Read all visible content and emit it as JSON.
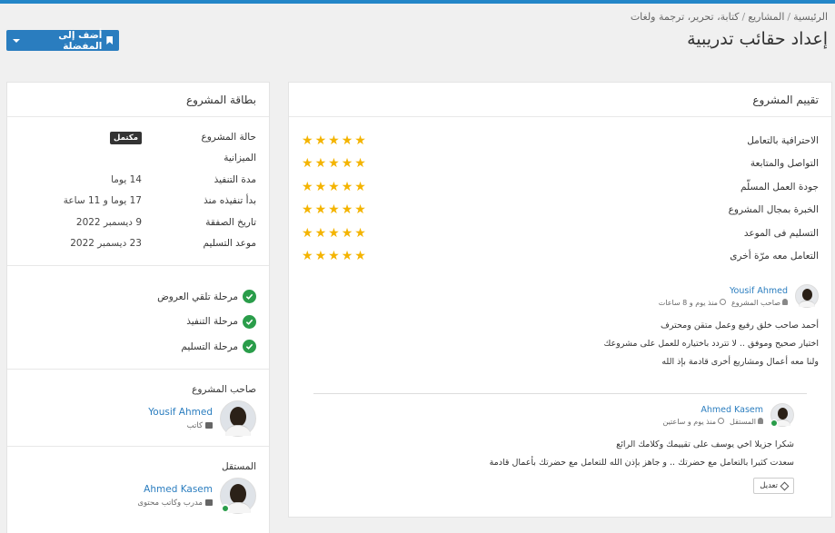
{
  "breadcrumb": [
    "الرئيسية",
    "المشاريع",
    "كتابة، تحرير، ترجمة ولغات"
  ],
  "page_title": "إعداد حقائب تدريبية",
  "favorite_button": {
    "label": "أضف إلى المفضلة"
  },
  "project_card": {
    "title": "بطاقة المشروع",
    "rows": [
      {
        "key": "حالة المشروع",
        "value": "مكتمل"
      },
      {
        "key": "الميزانية",
        "value": ""
      },
      {
        "key": "مدة التنفيذ",
        "value": "14 يوما"
      },
      {
        "key": "بدأ تنفيذه منذ",
        "value": "17 يوما و 11 ساعة"
      },
      {
        "key": "تاريخ الصفقة",
        "value": "9 ديسمبر 2022"
      },
      {
        "key": "موعد التسليم",
        "value": "23 ديسمبر 2022"
      }
    ],
    "steps": [
      "مرحلة تلقي العروض",
      "مرحلة التنفيذ",
      "مرحلة التسليم"
    ],
    "owner": {
      "label": "صاحب المشروع",
      "name": "Yousif Ahmed",
      "role": "كاتب"
    },
    "freelancer": {
      "label": "المستقل",
      "name": "Ahmed Kasem",
      "role": "مدرب وكاتب محتوى"
    }
  },
  "rating_card": {
    "title": "تقييم المشروع",
    "criteria": [
      {
        "label": "الاحترافية بالتعامل",
        "stars": 5
      },
      {
        "label": "التواصل والمتابعة",
        "stars": 5
      },
      {
        "label": "جودة العمل المسلّم",
        "stars": 5
      },
      {
        "label": "الخبرة بمجال المشروع",
        "stars": 5
      },
      {
        "label": "التسليم فى الموعد",
        "stars": 5
      },
      {
        "label": "التعامل معه مرّة أخرى",
        "stars": 5
      }
    ],
    "review": {
      "name": "Yousif Ahmed",
      "role": "صاحب المشروع",
      "time": "منذ يوم و 8 ساعات",
      "lines": [
        "أحمد صاحب خلق رفيع وعمل متقن ومحترف",
        "اختيار صحيح وموفق .. لا تتردد باختياره للعمل على مشروعك",
        "ولنا معه أعمال ومشاريع أخرى قادمة بإذ الله"
      ]
    },
    "reply": {
      "name": "Ahmed Kasem",
      "role": "المستقل",
      "time": "منذ يوم و ساعتين",
      "lines": [
        "شكرا جزيلا اخي يوسف على تقييمك وكلامك الرائع",
        "سعدت كثيرا بالتعامل مع حضرتك .. و جاهز بإذن الله للتعامل مع حضرتك بأعمال قادمة"
      ],
      "edit_label": "تعديل"
    }
  },
  "colors": {
    "accent": "#2a7dbf",
    "success": "#2a9d4a",
    "star": "#f4b400"
  }
}
